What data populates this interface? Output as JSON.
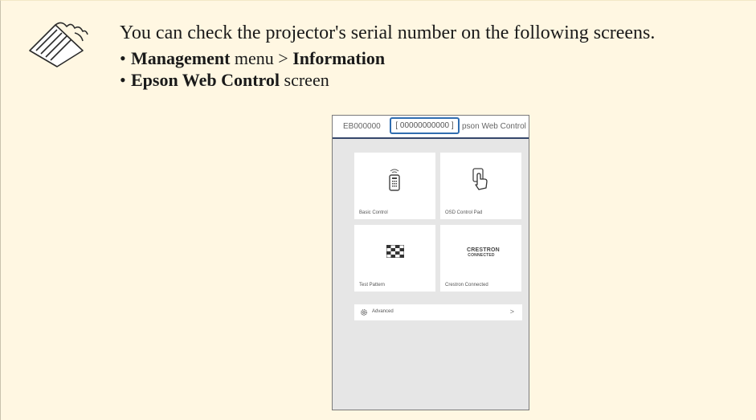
{
  "note": {
    "intro": "You can check the projector's serial number on the following screens.",
    "items": [
      {
        "bold": "Management",
        "mid": " menu > ",
        "bold2": "Information",
        "tail": ""
      },
      {
        "bold": "Epson Web Control",
        "mid": " screen",
        "bold2": "",
        "tail": ""
      }
    ]
  },
  "screen": {
    "header_model": "EB000000",
    "header_serial": "[ 00000000000 ]",
    "header_title": "pson Web Control",
    "tiles": [
      {
        "label": "Basic Control",
        "icon": "remote-control-icon"
      },
      {
        "label": "OSD Control Pad",
        "icon": "touch-hand-icon"
      },
      {
        "label": "Test Pattern",
        "icon": "checkerboard-icon"
      },
      {
        "label": "Crestron Connected",
        "icon": "crestron-logo"
      }
    ],
    "crestron_logo": "CRESTRON CONNECTED",
    "advanced_label": "Advanced",
    "advanced_chevron": ">"
  },
  "colors": {
    "note_background": "#fff7e2",
    "header_underline": "#35476b",
    "serial_highlight": "#2f6db0"
  }
}
